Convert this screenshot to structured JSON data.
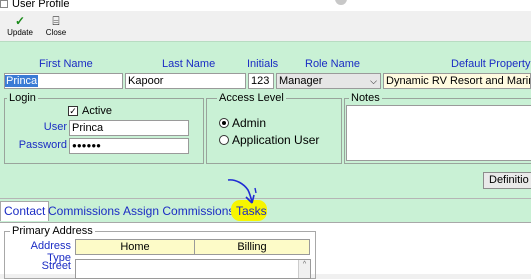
{
  "window": {
    "title": "User Profile"
  },
  "toolbar": {
    "update_label": "Update",
    "close_label": "Close",
    "update_icon": "✓",
    "close_icon": "⌸"
  },
  "headers": {
    "first_name": "First Name",
    "last_name": "Last Name",
    "initials": "Initials",
    "role_name": "Role Name",
    "default_property": "Default Property L"
  },
  "user": {
    "first_name": "Princa",
    "last_name": "Kapoor",
    "initials": "123",
    "role": "Manager",
    "default_property": "Dynamic RV Resort and Marina"
  },
  "login": {
    "title": "Login",
    "active_label": "Active",
    "active_checked": true,
    "user_label": "User",
    "user_value": "Princa",
    "password_label": "Password",
    "password_value": "●●●●●●"
  },
  "access_level": {
    "title": "Access Level",
    "options": [
      "Admin",
      "Application User"
    ],
    "selected": "Admin"
  },
  "notes": {
    "title": "Notes"
  },
  "definitions_button": "Definitio",
  "tabs": [
    "Contact",
    "Commissions",
    "Assign Commissions",
    "Tasks"
  ],
  "active_tab": "Contact",
  "contact": {
    "primary_address_title": "Primary Address",
    "address_type_label": "Address Type",
    "address_types": [
      "Home",
      "Billing"
    ],
    "street_label": "Street"
  },
  "colors": {
    "main_bg": "#c9f1d5",
    "label_blue": "#1b2cc4",
    "highlight": "#f7f500",
    "annotation": "#1f2bd4"
  }
}
